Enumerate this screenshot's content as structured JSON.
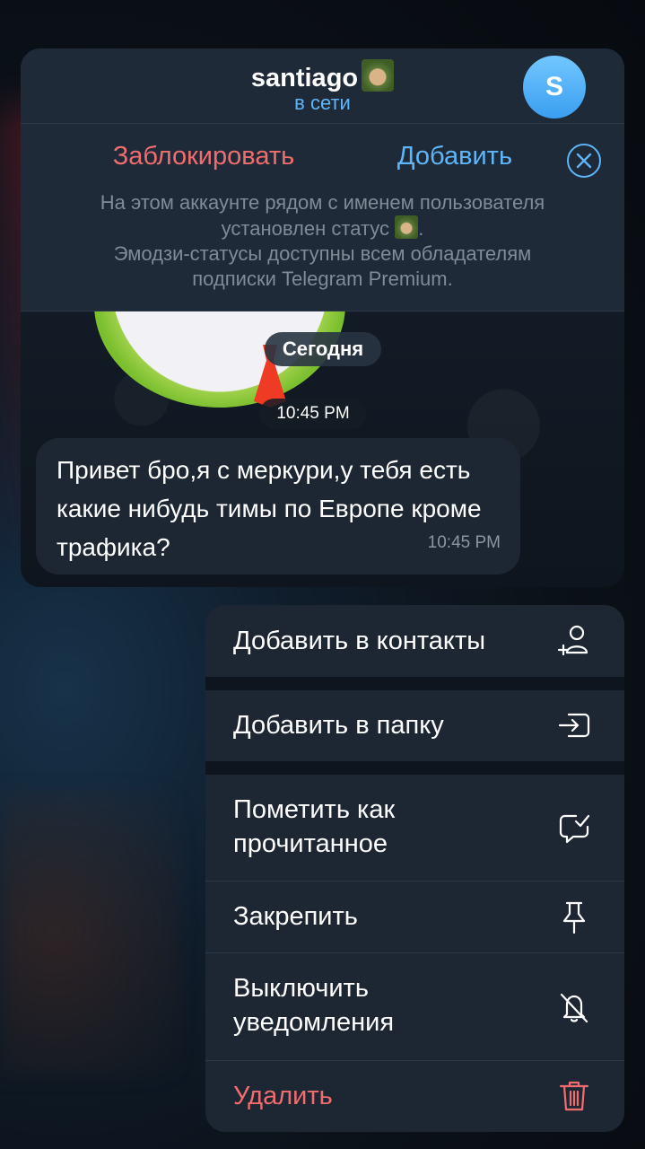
{
  "chat": {
    "name": "santiago",
    "status": "в сети",
    "avatar_letter": "S",
    "banner": {
      "block_label": "Заблокировать",
      "add_label": "Добавить",
      "info_line1": "На этом аккаунте рядом с именем пользователя",
      "info_line2_before": "установлен статус",
      "info_line2_after": ".",
      "info_line3": "Эмодзи-статусы доступны всем обладателям",
      "info_line4": "подписки Telegram Premium."
    },
    "date_separator": "Сегодня",
    "sticker_time": "10:45 PM",
    "message": {
      "text": "Привет бро,я с меркури,у тебя есть какие нибудь тимы по Европе кроме трафика?",
      "time": "10:45 PM"
    }
  },
  "menu": {
    "items": [
      {
        "label": "Добавить в контакты",
        "icon": "add-contact-icon"
      },
      {
        "label": "Добавить в папку",
        "icon": "add-to-folder-icon"
      },
      {
        "label": "Пометить как прочитанное",
        "icon": "mark-read-icon"
      },
      {
        "label": "Закрепить",
        "icon": "pin-icon"
      },
      {
        "label": "Выключить уведомления",
        "icon": "mute-bell-icon"
      },
      {
        "label": "Удалить",
        "icon": "trash-icon"
      }
    ]
  },
  "colors": {
    "accent": "#5eb5f7",
    "danger": "#f16d6d",
    "panel": "#1d2733"
  }
}
